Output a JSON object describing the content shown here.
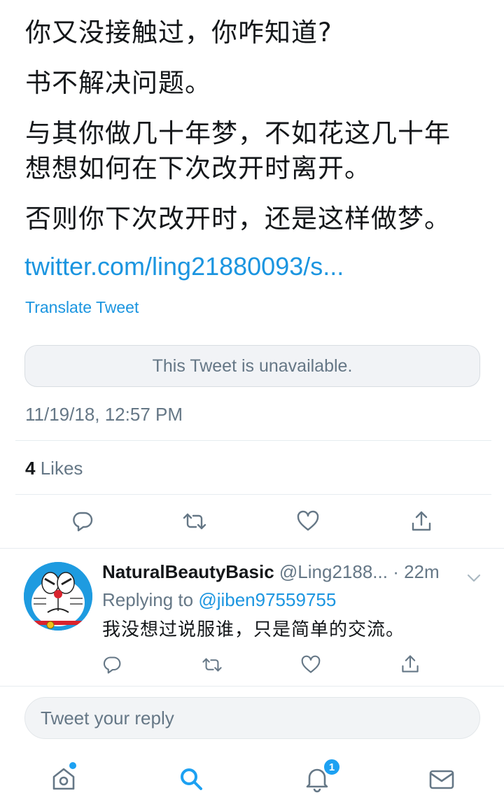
{
  "tweet": {
    "lines": [
      "你又没接触过，你咋知道?",
      "书不解决问题。",
      "与其你做几十年梦，不如花这几十年",
      "想想如何在下次改开时离开。",
      "否则你下次改开时，还是这样做梦。"
    ],
    "link": "twitter.com/ling21880093/s...",
    "translate": "Translate Tweet",
    "quoted_unavailable": "This Tweet is unavailable.",
    "timestamp": "11/19/18, 12:57 PM",
    "likes_count": "4",
    "likes_label": "Likes"
  },
  "actions": {
    "reply_icon": "reply-icon",
    "retweet_icon": "retweet-icon",
    "like_icon": "heart-icon",
    "share_icon": "share-icon"
  },
  "reply": {
    "name": "NaturalBeautyBasic",
    "handle": "@Ling2188...",
    "time": "· 22m",
    "replying_prefix": "Replying to",
    "replying_to": "@jiben97559755",
    "text": "我没想过说服谁，只是简单的交流。"
  },
  "composer": {
    "placeholder": "Tweet your reply"
  },
  "tabbar": {
    "home_icon": "home-icon",
    "search_icon": "search-icon",
    "notifications_icon": "bell-icon",
    "messages_icon": "mail-icon",
    "notification_badge": "1"
  },
  "colors": {
    "accent": "#1da1f2",
    "link": "#1b95e0",
    "muted": "#657786",
    "text": "#14171a"
  }
}
